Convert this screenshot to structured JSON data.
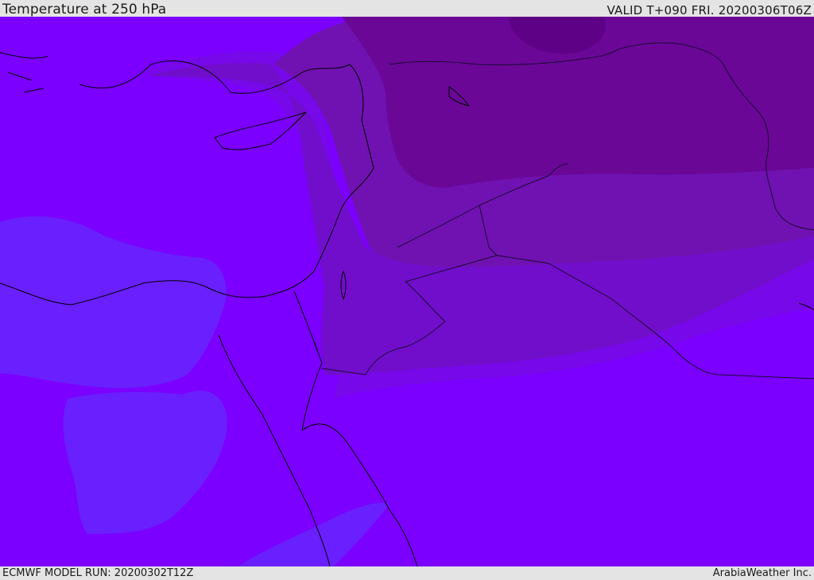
{
  "header": {
    "title": "Temperature at 250 hPa",
    "valid": "VALID T+090 FRI. 20200306T06Z"
  },
  "footer": {
    "model_run": "ECMWF MODEL RUN: 20200302T12Z",
    "brand": "ArabiaWeather Inc."
  },
  "map": {
    "colors": {
      "base": "#7b00ff",
      "cool_band": "#6a1fff",
      "warm_1": "#7708e9",
      "warm_2": "#710ecb",
      "warm_3": "#7012b1",
      "warm_4": "#6a0797",
      "warm_5": "#5f0187",
      "coast": "#000000",
      "border": "#1a0a33"
    }
  }
}
